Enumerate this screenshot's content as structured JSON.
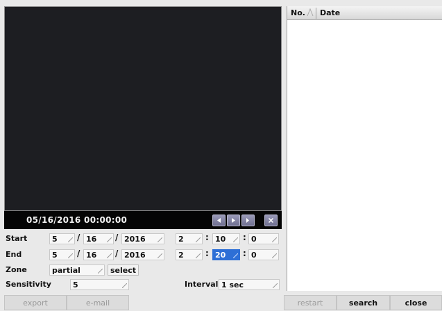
{
  "player": {
    "timestamp": "05/16/2016 00:00:00",
    "controls": [
      "rewind-icon",
      "play-icon",
      "step-forward-icon",
      "close-icon"
    ]
  },
  "list": {
    "col_no": "No.",
    "col_date": "Date"
  },
  "form": {
    "start_label": "Start",
    "end_label": "End",
    "zone_label": "Zone",
    "sensitivity_label": "Sensitivity",
    "interval_label": "Interval",
    "date_sep": "/",
    "time_sep": ":",
    "start": {
      "month": "5",
      "day": "16",
      "year": "2016",
      "hour": "2",
      "minute": "10",
      "second": "0"
    },
    "end": {
      "month": "5",
      "day": "16",
      "year": "2016",
      "hour": "2",
      "minute": "20",
      "second": "0"
    },
    "zone_value": "partial",
    "zone_select": "select",
    "sensitivity_value": "5",
    "interval_value": "1 sec"
  },
  "buttons": {
    "export": "export",
    "email": "e-mail",
    "restart": "restart",
    "search": "search",
    "close": "close"
  },
  "colors": {
    "selected_field": "#2d6fd6",
    "video_bg": "#1d1e22"
  }
}
